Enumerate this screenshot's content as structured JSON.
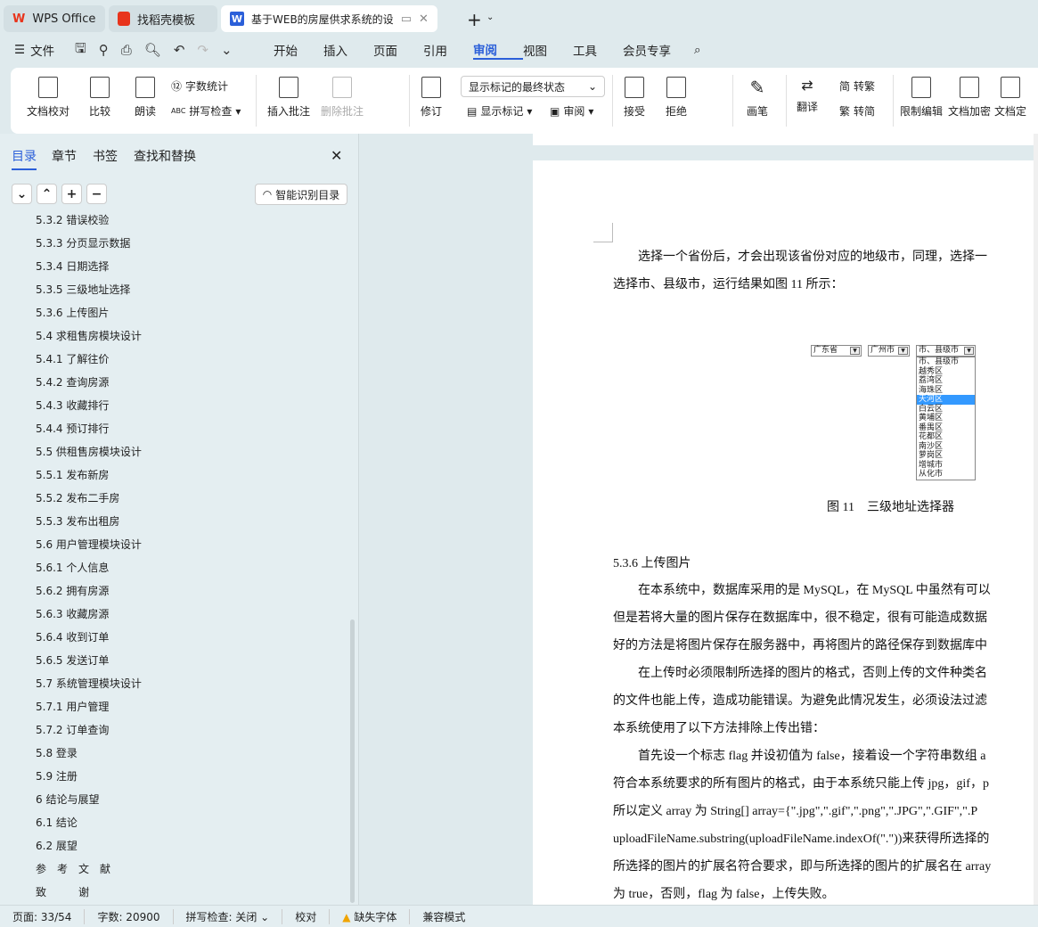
{
  "tabs": [
    {
      "label": "WPS Office"
    },
    {
      "label": "找稻壳模板"
    },
    {
      "label": "基于WEB的房屋供求系统的设"
    }
  ],
  "menu": {
    "file": "文件",
    "items": [
      "开始",
      "插入",
      "页面",
      "引用",
      "审阅",
      "视图",
      "工具",
      "会员专享"
    ],
    "active": "审阅"
  },
  "ribbon": {
    "proof": "文档校对",
    "compare": "比较",
    "read": "朗读",
    "wordcount": "字数统计",
    "spell": "拼写检查",
    "insert_comment": "插入批注",
    "delete_comment": "删除批注",
    "revise": "修订",
    "markup_state": "显示标记的最终状态",
    "show_markup": "显示标记",
    "review": "审阅",
    "accept": "接受",
    "reject": "拒绝",
    "pen": "画笔",
    "translate": "翻译",
    "to_trad": "转繁",
    "to_simp": "转简",
    "restrict": "限制编辑",
    "encrypt": "文档加密",
    "verify": "文档定"
  },
  "sidebar": {
    "tabs": [
      "目录",
      "章节",
      "书签",
      "查找和替换"
    ],
    "smart_toc": "智能识别目录",
    "toc": [
      "5.3.2 错误校验",
      "5.3.3 分页显示数据",
      "5.3.4 日期选择",
      "5.3.5 三级地址选择",
      "5.3.6 上传图片",
      "5.4 求租售房模块设计",
      "5.4.1 了解往价",
      "5.4.2 查询房源",
      "5.4.3 收藏排行",
      "5.4.4 预订排行",
      "5.5 供租售房模块设计",
      "5.5.1 发布新房",
      "5.5.2 发布二手房",
      "5.5.3 发布出租房",
      "5.6 用户管理模块设计",
      "5.6.1 个人信息",
      "5.6.2 拥有房源",
      "5.6.3 收藏房源",
      "5.6.4 收到订单",
      "5.6.5 发送订单",
      "5.7 系统管理模块设计",
      "5.7.1 用户管理",
      "5.7.2 订单查询",
      "5.8 登录",
      "5.9 注册",
      "6 结论与展望",
      "6.1 结论",
      "6.2 展望",
      "参　考　文　献",
      "致　　　谢"
    ]
  },
  "document": {
    "lines1": [
      "　　选择一个省份后，才会出现该省份对应的地级市，同理，选择一",
      "选择市、县级市，运行结果如图 11 所示："
    ],
    "figure": {
      "province": "广东省",
      "city": "广州市",
      "district": "市、县级市",
      "options": [
        "市、县级市",
        "越秀区",
        "荔湾区",
        "海珠区",
        "天河区",
        "白云区",
        "黄埔区",
        "番禺区",
        "花都区",
        "南沙区",
        "萝岗区",
        "增城市",
        "从化市"
      ],
      "selected": "天河区"
    },
    "caption": "图 11　三级地址选择器",
    "heading": "5.3.6 上传图片",
    "lines2": [
      "　　在本系统中，数据库采用的是 MySQL，在 MySQL 中虽然有可以",
      "但是若将大量的图片保存在数据库中，很不稳定，很有可能造成数据",
      "好的方法是将图片保存在服务器中，再将图片的路径保存到数据库中",
      "　　在上传时必须限制所选择的图片的格式，否则上传的文件种类名",
      "的文件也能上传，造成功能错误。为避免此情况发生，必须设法过滤",
      "本系统使用了以下方法排除上传出错：",
      "　　首先设一个标志 flag 并设初值为 false，接着设一个字符串数组 a",
      "符合本系统要求的所有图片的格式，由于本系统只能上传 jpg，gif，p",
      "所以定义 array 为 String[] array={\".jpg\",\".gif\",\".png\",\".JPG\",\".GIF\",\".P",
      "uploadFileName.substring(uploadFileName.indexOf(\".\"))来获得所选择的",
      "所选择的图片的扩展名符合要求，即与所选择的图片的扩展名在 array",
      "为 true，否则，flag 为 false，上传失败。"
    ]
  },
  "status": {
    "page": "页面: 33/54",
    "words": "字数: 20900",
    "spell": "拼写检查: 关闭",
    "proof": "校对",
    "missing_font": "缺失字体",
    "compat": "兼容模式"
  },
  "colors": {
    "accent": "#2b5fd9",
    "wps_red": "#e8341c"
  }
}
